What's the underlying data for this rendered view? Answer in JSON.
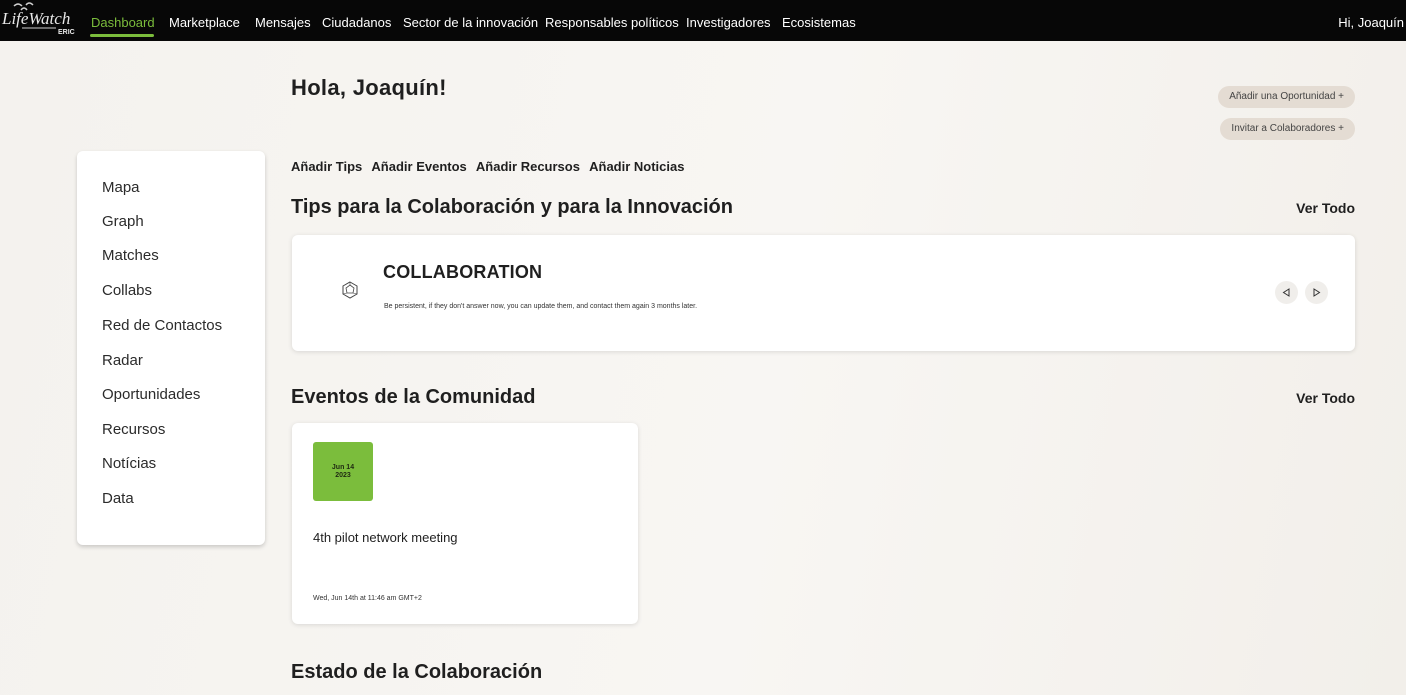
{
  "nav": {
    "logo_text": "LifeWatch ERIC",
    "items": [
      "Dashboard",
      "Marketplace",
      "Mensajes",
      "Ciudadanos",
      "Sector de la innovación",
      "Responsables políticos",
      "Investigadores",
      "Ecosistemas"
    ],
    "active": "Dashboard",
    "greeting": "Hi, Joaquín"
  },
  "sidebar": {
    "items": [
      "Mapa",
      "Graph",
      "Matches",
      "Collabs",
      "Red de Contactos",
      "Radar",
      "Oportunidades",
      "Recursos",
      "Notícias",
      "Data"
    ]
  },
  "main": {
    "hello": "Hola, Joaquín!",
    "buttons": {
      "add_opportunity": "Añadir una Oportunidad +",
      "invite_collaborators": "Invitar a Colaboradores +"
    },
    "add_links": [
      "Añadir Tips",
      "Añadir Eventos",
      "Añadir Recursos",
      "Añadir Noticias"
    ],
    "tips_section": {
      "title": "Tips para la Colaboración y para la Innovación",
      "see_all": "Ver Todo",
      "tip_title": "COLLABORATION",
      "tip_text": "Be persistent, if they don't answer now, you can update them, and contact them again 3 months later."
    },
    "events_section": {
      "title": "Eventos de la Comunidad",
      "see_all": "Ver Todo",
      "event": {
        "date_day": "Jun 14",
        "date_year": "2023",
        "title": "4th pilot network meeting",
        "time": "Wed, Jun 14th at 11:46 am GMT+2"
      }
    },
    "status_section": {
      "title": "Estado de la Colaboración"
    }
  },
  "colors": {
    "accent": "#7bbd3c",
    "topbar": "#070707",
    "pill": "#e4dcd3"
  }
}
